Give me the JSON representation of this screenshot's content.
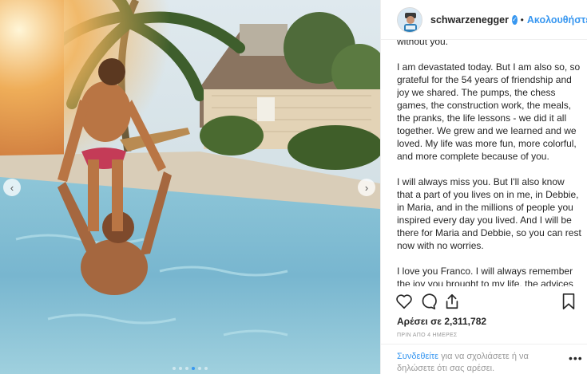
{
  "header": {
    "username": "schwarzenegger",
    "follow_label": "Ακολουθήστε",
    "separator": "•"
  },
  "caption": {
    "paragraphs": [
      "without you.",
      "I am devastated today. But I am also so, so grateful for the 54 years of friendship and joy we shared. The pumps, the chess games, the construction work, the meals, the pranks, the life lessons - we did it all together. We grew and we learned and we loved. My life was more fun, more colorful, and more complete because of you.",
      "I will always miss you. But I'll also know that a part of you lives on in me, in Debbie, in Maria, and in the millions of people you inspired every day you lived. And I will be there for Maria and Debbie, so you can rest now with no worries.",
      "I love you Franco. I will always remember the joy you brought to my life, the advices you gave me, and the twinkle in your eye"
    ]
  },
  "likes": "Αρέσει σε 2,311,782",
  "timestamp": "ΠΡΙΝ ΑΠΟ 4 ΗΜΕΡΕΣ",
  "login_prompt": {
    "link": "Συνδεθείτε",
    "text": " για να σχολιάσετε ή να δηλώσετε ότι σας αρέσει."
  },
  "more_label": "•••",
  "carousel": {
    "prev": "‹",
    "next": "›",
    "slide_count": 6,
    "active_slide": 3
  },
  "colors": {
    "accent": "#3897f0",
    "text": "#262626",
    "muted": "#999999"
  },
  "icons": [
    "heart-icon",
    "comment-icon",
    "share-icon",
    "bookmark-icon",
    "verified-icon",
    "more-icon"
  ]
}
